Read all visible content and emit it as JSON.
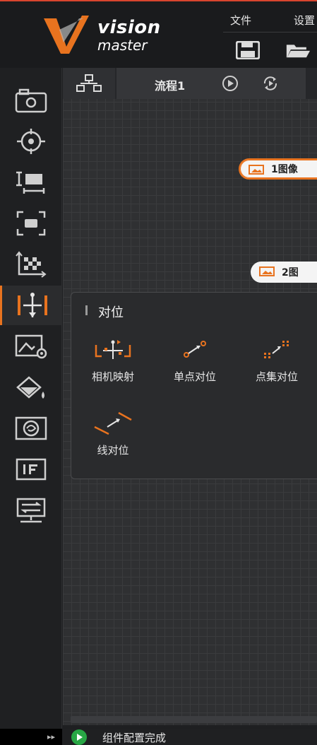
{
  "logo": {
    "line1": "vision",
    "line2": "master"
  },
  "menu": {
    "file": "文件",
    "settings": "设置"
  },
  "process": {
    "title": "流程1"
  },
  "nodes": [
    {
      "label": "1图像"
    },
    {
      "label": "2图"
    }
  ],
  "panel": {
    "title": "对位",
    "tools": [
      {
        "label": "相机映射",
        "icon": "camera-mapping-icon"
      },
      {
        "label": "单点对位",
        "icon": "single-point-align-icon"
      },
      {
        "label": "点集对位",
        "icon": "point-set-align-icon"
      },
      {
        "label": "线对位",
        "icon": "line-align-icon"
      }
    ]
  },
  "status": {
    "text": "组件配置完成"
  },
  "sidebar": {
    "items": [
      "camera-icon",
      "crosshair-target-icon",
      "measure-icon",
      "focus-frame-icon",
      "calibration-grid-icon",
      "alignment-icon",
      "image-settings-icon",
      "color-fill-icon",
      "lens-icon",
      "if-logic-icon",
      "communication-icon"
    ]
  },
  "colors": {
    "accent": "#e8731f",
    "success": "#28a745",
    "logo_orange": "#e8731f"
  }
}
